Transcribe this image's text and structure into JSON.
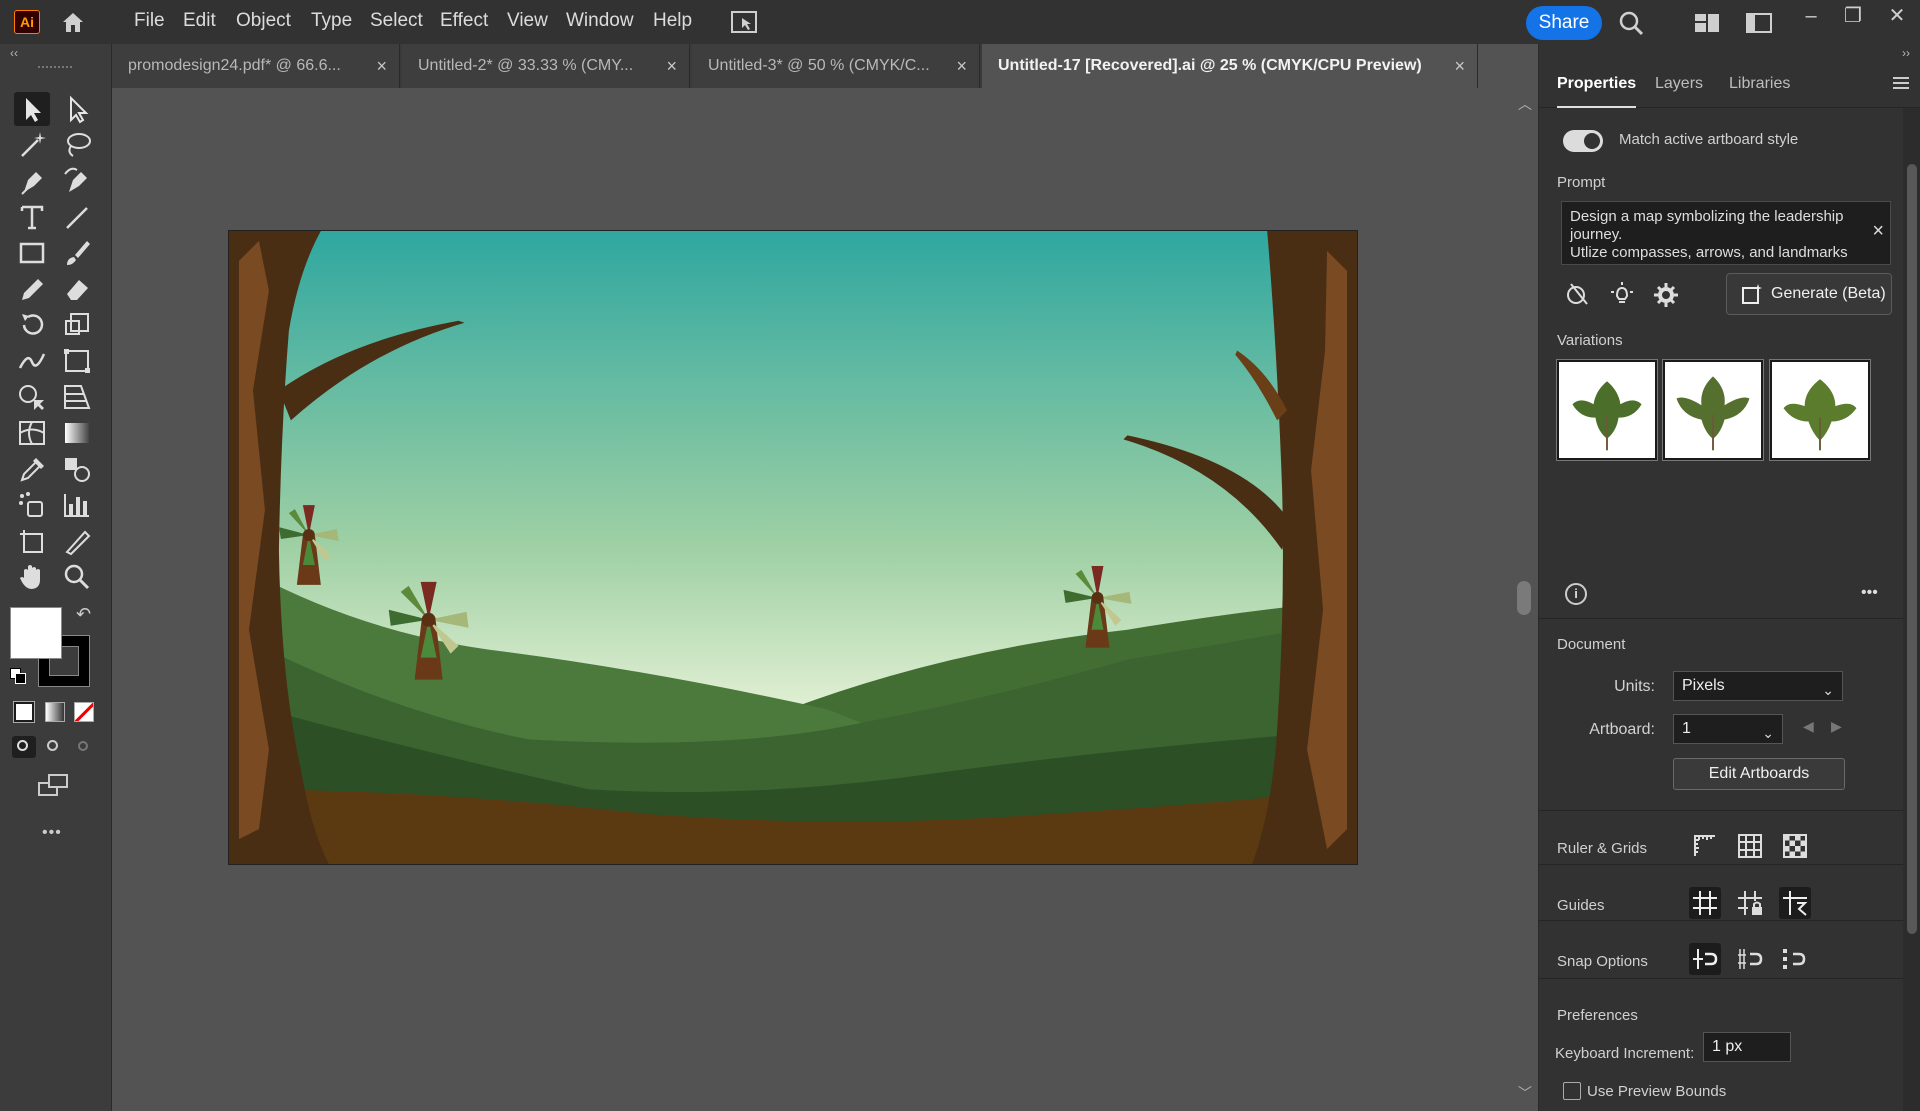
{
  "app": {
    "logo_text": "Ai",
    "menu": [
      "File",
      "Edit",
      "Object",
      "Type",
      "Select",
      "Effect",
      "View",
      "Window",
      "Help"
    ],
    "share_label": "Share",
    "icons": [
      "home-icon",
      "arrange-documents-icon",
      "search-icon",
      "workspace-switcher-icon",
      "panels-icon",
      "minimize-icon",
      "restore-icon",
      "close-icon"
    ]
  },
  "tabs": [
    {
      "label": "promodesign24.pdf* @ 66.6...",
      "close": "×"
    },
    {
      "label": "Untitled-2* @ 33.33 % (CMY...",
      "close": "×"
    },
    {
      "label": "Untitled-3* @ 50 % (CMYK/C...",
      "close": "×"
    },
    {
      "label": "Untitled-17 [Recovered].ai @ 25 % (CMYK/CPU Preview)",
      "close": "×",
      "active": true
    }
  ],
  "toolbar": {
    "collapse": "‹‹",
    "more": "•••",
    "tools": [
      "selection",
      "direct-selection",
      "magic-wand",
      "lasso",
      "pen",
      "curvature",
      "type",
      "line-segment",
      "rectangle",
      "paintbrush",
      "pencil",
      "eraser",
      "rotate",
      "scale",
      "width",
      "free-transform",
      "shape-builder",
      "perspective-grid",
      "mesh",
      "gradient",
      "eyedropper",
      "blend",
      "symbol-sprayer",
      "column-graph",
      "artboard",
      "slice",
      "hand",
      "zoom"
    ],
    "fill_color": "#ffffff",
    "stroke_color": "#000000"
  },
  "canvas": {
    "artboard_sky_top": "#2fa7a0",
    "artboard_sky_bottom": "#e8f3d8"
  },
  "panel": {
    "collapse": "››",
    "tabs": [
      "Properties",
      "Layers",
      "Libraries"
    ],
    "match_style_label": "Match active artboard style",
    "prompt_label": "Prompt",
    "prompt_text": "Design a map symbolizing the leadership journey.\nUtlize compasses, arrows, and landmarks to",
    "prompt_clear": "×",
    "generate_label": "Generate (Beta)",
    "variations_label": "Variations",
    "info": "i",
    "more": "•••",
    "document_label": "Document",
    "units_label": "Units:",
    "units_value": "Pixels",
    "artboard_label": "Artboard:",
    "artboard_value": "1",
    "edit_artboards_label": "Edit Artboards",
    "ruler_grids_label": "Ruler & Grids",
    "guides_label": "Guides",
    "snap_label": "Snap Options",
    "preferences_label": "Preferences",
    "keyboard_increment_label": "Keyboard Increment:",
    "keyboard_increment_value": "1 px",
    "preview_bounds_label": "Use Preview Bounds"
  }
}
